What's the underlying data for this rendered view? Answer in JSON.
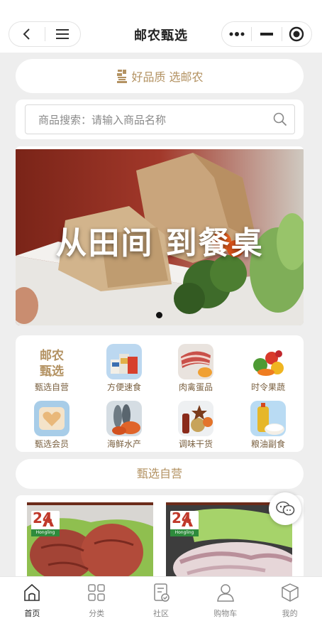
{
  "header": {
    "title": "邮农甄选",
    "back_icon": "chevron-left-icon",
    "menu_icon": "menu-icon",
    "more_icon": "more-dots-icon",
    "minimize_icon": "minimize-icon",
    "close_icon": "target-circle-icon"
  },
  "slogan": {
    "text": "好品质 选邮农",
    "logo_icon": "brand-logo-icon"
  },
  "search": {
    "placeholder": "商品搜索：请输入商品名称",
    "icon": "search-icon"
  },
  "banner": {
    "headline": "从田间 到餐桌",
    "active_slide": 1,
    "slides": 1
  },
  "categories": [
    {
      "label": "甄选自营",
      "icon": "brand-seal-icon"
    },
    {
      "label": "方便速食",
      "icon": "instant-food-icon"
    },
    {
      "label": "肉禽蛋品",
      "icon": "meat-icon"
    },
    {
      "label": "时令果蔬",
      "icon": "vegetables-icon"
    },
    {
      "label": "甄选会员",
      "icon": "member-heart-icon"
    },
    {
      "label": "海鲜水产",
      "icon": "seafood-icon"
    },
    {
      "label": "调味干货",
      "icon": "seasoning-icon"
    },
    {
      "label": "粮油副食",
      "icon": "grain-oil-icon"
    }
  ],
  "section": {
    "title": "甄选自营"
  },
  "products": [
    {
      "badge_number": "24",
      "badge_text": "Hongling",
      "image": "braised-meat-image"
    },
    {
      "badge_number": "24",
      "badge_text": "Hongling",
      "image": "sliced-meat-image"
    }
  ],
  "chat": {
    "icon": "chat-bubble-icon"
  },
  "tabbar": [
    {
      "label": "首页",
      "icon": "home-icon",
      "active": true
    },
    {
      "label": "分类",
      "icon": "grid-icon",
      "active": false
    },
    {
      "label": "社区",
      "icon": "community-icon",
      "active": false
    },
    {
      "label": "购物车",
      "icon": "user-icon",
      "active": false
    },
    {
      "label": "我的",
      "icon": "box-icon",
      "active": false
    }
  ],
  "colors": {
    "accent": "#b39262",
    "background": "#eeeeee",
    "text_dark": "#222222"
  }
}
